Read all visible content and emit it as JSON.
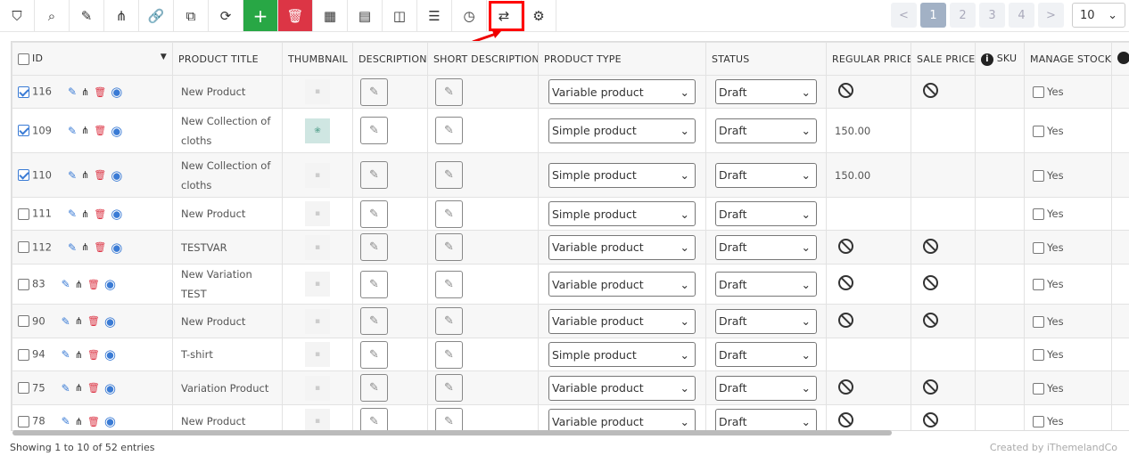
{
  "toolbar": {
    "buttons": [
      {
        "name": "filter-icon",
        "glyph": "⛉"
      },
      {
        "name": "search-icon",
        "glyph": "⌕"
      },
      {
        "name": "edit-icon",
        "glyph": "✎"
      },
      {
        "name": "hierarchy-icon",
        "glyph": "⋔"
      },
      {
        "name": "link-icon",
        "glyph": "🔗"
      },
      {
        "name": "duplicate-icon",
        "glyph": "⧉"
      },
      {
        "name": "refresh-icon",
        "glyph": "⟳"
      },
      {
        "name": "add-icon",
        "glyph": "+"
      },
      {
        "name": "delete-icon",
        "glyph": "🗑"
      },
      {
        "name": "table-icon",
        "glyph": "▦"
      },
      {
        "name": "calculator-icon",
        "glyph": "▤"
      },
      {
        "name": "columns-icon",
        "glyph": "◫"
      },
      {
        "name": "list-icon",
        "glyph": "☰"
      },
      {
        "name": "history-icon",
        "glyph": "◷"
      },
      {
        "name": "swap-icon",
        "glyph": "⇄"
      },
      {
        "name": "gear-icon",
        "glyph": "⚙"
      }
    ],
    "highlight_color": "#ff0000",
    "add_color": "#28a745",
    "delete_color": "#dc3545"
  },
  "pagination": {
    "prev": "<",
    "pages": [
      "1",
      "2",
      "3",
      "4"
    ],
    "active": "1",
    "next": ">",
    "per_page": "10"
  },
  "columns": [
    "ID",
    "PRODUCT TITLE",
    "THUMBNAIL",
    "DESCRIPTION",
    "SHORT DESCRIPTION",
    "PRODUCT TYPE",
    "STATUS",
    "REGULAR PRICE",
    "SALE PRICE",
    "SKU",
    "MANAGE STOCK"
  ],
  "rows": [
    {
      "id": "116",
      "checked": true,
      "title": "New Product",
      "thumb": false,
      "type": "Variable product",
      "status": "Draft",
      "regular": "ban",
      "sale": "ban",
      "stock": "Yes"
    },
    {
      "id": "109",
      "checked": true,
      "title": "New Collection of cloths",
      "thumb": true,
      "type": "Simple product",
      "status": "Draft",
      "regular": "150.00",
      "sale": "",
      "stock": "Yes"
    },
    {
      "id": "110",
      "checked": true,
      "title": "New Collection of cloths",
      "thumb": false,
      "type": "Simple product",
      "status": "Draft",
      "regular": "150.00",
      "sale": "",
      "stock": "Yes"
    },
    {
      "id": "111",
      "checked": false,
      "title": "New Product",
      "thumb": false,
      "type": "Simple product",
      "status": "Draft",
      "regular": "",
      "sale": "",
      "stock": "Yes"
    },
    {
      "id": "112",
      "checked": false,
      "title": "TESTVAR",
      "thumb": false,
      "type": "Variable product",
      "status": "Draft",
      "regular": "ban",
      "sale": "ban",
      "stock": "Yes"
    },
    {
      "id": "83",
      "checked": false,
      "title": "New Variation TEST",
      "thumb": false,
      "type": "Variable product",
      "status": "Draft",
      "regular": "ban",
      "sale": "ban",
      "stock": "Yes"
    },
    {
      "id": "90",
      "checked": false,
      "title": "New Product",
      "thumb": false,
      "type": "Variable product",
      "status": "Draft",
      "regular": "ban",
      "sale": "ban",
      "stock": "Yes"
    },
    {
      "id": "94",
      "checked": false,
      "title": "T-shirt",
      "thumb": false,
      "type": "Simple product",
      "status": "Draft",
      "regular": "",
      "sale": "",
      "stock": "Yes"
    },
    {
      "id": "75",
      "checked": false,
      "title": "Variation Product",
      "thumb": false,
      "type": "Variable product",
      "status": "Draft",
      "regular": "ban",
      "sale": "ban",
      "stock": "Yes"
    },
    {
      "id": "78",
      "checked": false,
      "title": "New Product",
      "thumb": false,
      "type": "Variable product",
      "status": "Draft",
      "regular": "ban",
      "sale": "ban",
      "stock": "Yes"
    }
  ],
  "footer": {
    "showing": "Showing 1 to 10 of 52 entries",
    "credit": "Created by iThemelandCo"
  }
}
